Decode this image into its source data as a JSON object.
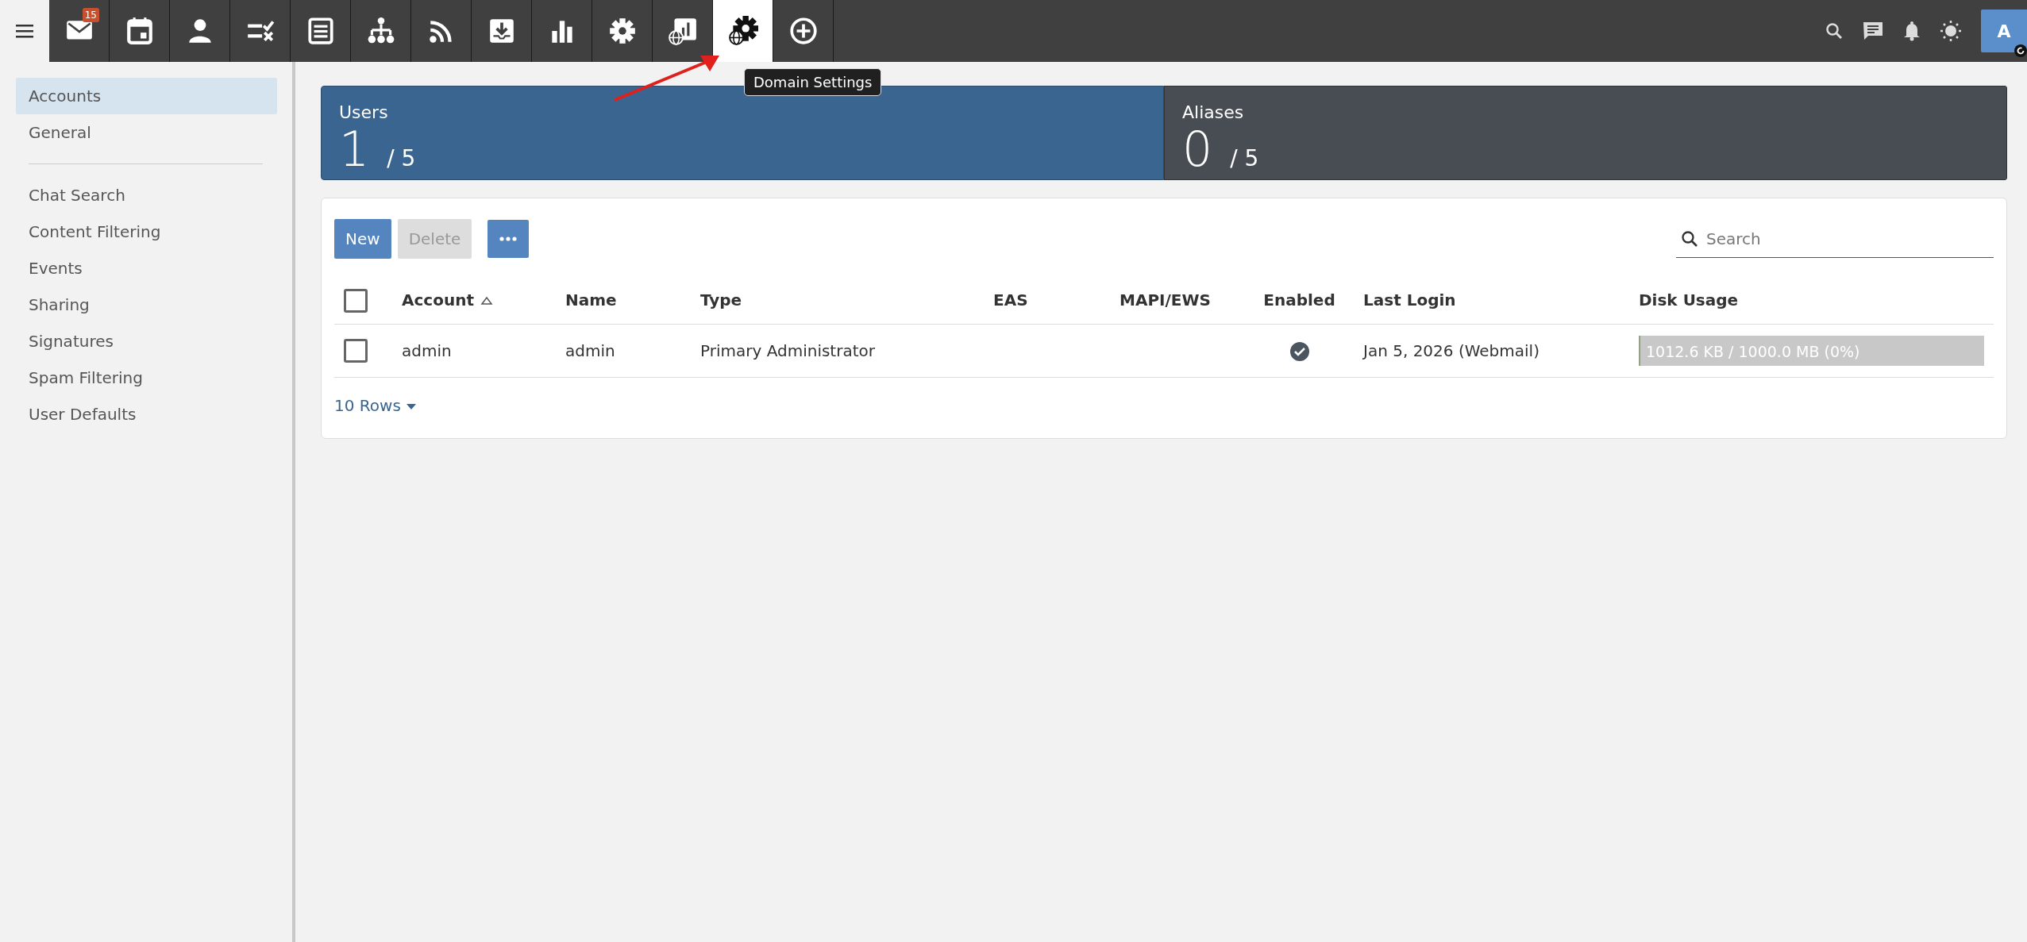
{
  "app_bar": {
    "tabs": [
      {
        "selected": false,
        "badge": "15"
      },
      {
        "selected": false
      },
      {
        "selected": false
      },
      {
        "selected": false
      },
      {
        "selected": false
      },
      {
        "selected": false
      },
      {
        "selected": false
      },
      {
        "selected": false
      },
      {
        "selected": false
      },
      {
        "selected": false
      },
      {
        "selected": false
      },
      {
        "selected": true
      },
      {
        "selected": false
      }
    ],
    "tooltip": "Domain Settings",
    "avatar": "A"
  },
  "sidebar": {
    "groups": [
      [
        {
          "label": "Accounts",
          "selected": true
        },
        {
          "label": "General",
          "selected": false
        }
      ],
      [
        {
          "label": "Chat Search",
          "selected": false
        },
        {
          "label": "Content Filtering",
          "selected": false
        },
        {
          "label": "Events",
          "selected": false
        },
        {
          "label": "Sharing",
          "selected": false
        },
        {
          "label": "Signatures",
          "selected": false
        },
        {
          "label": "Spam Filtering",
          "selected": false
        },
        {
          "label": "User Defaults",
          "selected": false
        }
      ]
    ]
  },
  "stats": [
    {
      "kind": "primary",
      "label": "Users",
      "count": "1",
      "limit": "/ 5"
    },
    {
      "kind": "secondary",
      "label": "Aliases",
      "count": "0",
      "limit": "/ 5"
    }
  ],
  "toolbar": {
    "buttons": [
      {
        "label": "New",
        "disabled": false
      },
      {
        "label": "Delete",
        "disabled": true
      }
    ],
    "search": {
      "placeholder": "Search"
    }
  },
  "table": {
    "select_all": {
      "checked": false
    },
    "columns": [
      {
        "label": "Account",
        "sorted": true
      },
      {
        "label": "Name",
        "sorted": false
      },
      {
        "label": "Type",
        "sorted": false
      },
      {
        "label": "EAS",
        "sorted": false
      },
      {
        "label": "MAPI/EWS",
        "sorted": false
      },
      {
        "label": "Enabled",
        "sorted": false
      },
      {
        "label": "Last Login",
        "sorted": false
      },
      {
        "label": "Disk Usage",
        "sorted": false
      }
    ],
    "rows": [
      {
        "checked": false,
        "account": "admin",
        "name": "admin",
        "type": "Primary Administrator",
        "enabled": true,
        "last_login": "Jan 5, 2026 (Webmail)",
        "disk_usage": {
          "text": "1012.6 KB / 1000.0 MB (0%)",
          "level": 0.001
        }
      }
    ]
  },
  "pager": "10 Rows"
}
